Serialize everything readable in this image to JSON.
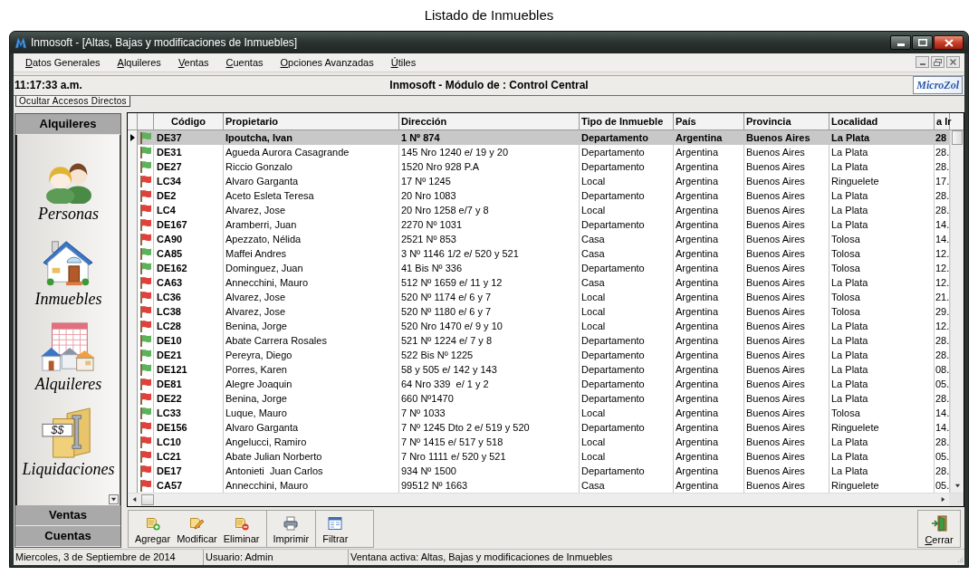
{
  "caption": "Listado de Inmuebles",
  "window": {
    "title": "Inmosoft - [Altas, Bajas y modificaciones de Inmuebles]"
  },
  "menu": [
    "Datos Generales",
    "Alquileres",
    "Ventas",
    "Cuentas",
    "Opciones Avanzadas",
    "Útiles"
  ],
  "header_bar": {
    "clock": "11:17:33 a.m.",
    "title": "Inmosoft - Módulo de : Control Central",
    "logo": "MicroZol"
  },
  "shortcuts_toggle": "Ocultar Accesos Directos",
  "sidebar": {
    "sections": [
      {
        "label": "Alquileres",
        "items": [
          {
            "label": "Personas",
            "kind": "people"
          },
          {
            "label": "Inmuebles",
            "kind": "house"
          },
          {
            "label": "Alquileres",
            "kind": "rentals"
          },
          {
            "label": "Liquidaciones",
            "kind": "settlement",
            "icon_text": "$$"
          }
        ]
      },
      {
        "label": "Ventas"
      },
      {
        "label": "Cuentas"
      }
    ]
  },
  "table": {
    "columns": [
      "Código",
      "Propietario",
      "Dirección",
      "Tipo de Inmueble",
      "País",
      "Provincia",
      "Localidad",
      "a Ir"
    ],
    "rows": [
      {
        "selected": true,
        "color": "#5db35a",
        "cells": [
          "DE37",
          "Ipoutcha, Ivan",
          "1 Nº 874",
          "Departamento",
          "Argentina",
          "Buenos Aires",
          "La Plata",
          "28"
        ]
      },
      {
        "selected": false,
        "color": "#5db35a",
        "cells": [
          "DE31",
          "Agueda Aurora Casagrande",
          "145 Nro 1240 e/ 19 y 20",
          "Departamento",
          "Argentina",
          "Buenos Aires",
          "La Plata",
          "28."
        ]
      },
      {
        "selected": false,
        "color": "#5db35a",
        "cells": [
          "DE27",
          "Riccio Gonzalo",
          "1520 Nro 928 P.A",
          "Departamento",
          "Argentina",
          "Buenos Aires",
          "La Plata",
          "28."
        ]
      },
      {
        "selected": false,
        "color": "#e2403a",
        "cells": [
          "LC34",
          "Alvaro Garganta",
          "17 Nº 1245",
          "Local",
          "Argentina",
          "Buenos Aires",
          "Ringuelete",
          "17."
        ]
      },
      {
        "selected": false,
        "color": "#e2403a",
        "cells": [
          "DE2",
          "Aceto Esleta Teresa",
          "20 Nro 1083",
          "Departamento",
          "Argentina",
          "Buenos Aires",
          "La Plata",
          "28."
        ]
      },
      {
        "selected": false,
        "color": "#e2403a",
        "cells": [
          "LC4",
          "Alvarez, Jose",
          "20 Nro 1258 e/7 y 8",
          "Local",
          "Argentina",
          "Buenos Aires",
          "La Plata",
          "28."
        ]
      },
      {
        "selected": false,
        "color": "#e2403a",
        "cells": [
          "DE167",
          "Aramberri, Juan",
          "2270 Nº 1031",
          "Departamento",
          "Argentina",
          "Buenos Aires",
          "La Plata",
          "14."
        ]
      },
      {
        "selected": false,
        "color": "#e2403a",
        "cells": [
          "CA90",
          "Apezzato, Nélida",
          "2521 Nº 853",
          "Casa",
          "Argentina",
          "Buenos Aires",
          "Tolosa",
          "14."
        ]
      },
      {
        "selected": false,
        "color": "#5db35a",
        "cells": [
          "CA85",
          "Maffei Andres",
          "3 Nº 1146 1/2 e/ 520 y 521",
          "Casa",
          "Argentina",
          "Buenos Aires",
          "Tolosa",
          "12."
        ]
      },
      {
        "selected": false,
        "color": "#5db35a",
        "cells": [
          "DE162",
          "Dominguez, Juan",
          "41 Bis Nº 336",
          "Departamento",
          "Argentina",
          "Buenos Aires",
          "Tolosa",
          "12."
        ]
      },
      {
        "selected": false,
        "color": "#e2403a",
        "cells": [
          "CA63",
          "Annecchini, Mauro",
          "512 Nº 1659 e/ 11 y 12",
          "Casa",
          "Argentina",
          "Buenos Aires",
          "La Plata",
          "12."
        ]
      },
      {
        "selected": false,
        "color": "#e2403a",
        "cells": [
          "LC36",
          "Alvarez, Jose",
          "520 Nº 1174 e/ 6 y 7",
          "Local",
          "Argentina",
          "Buenos Aires",
          "Tolosa",
          "21."
        ]
      },
      {
        "selected": false,
        "color": "#e2403a",
        "cells": [
          "LC38",
          "Alvarez, Jose",
          "520 Nº 1180 e/ 6 y 7",
          "Local",
          "Argentina",
          "Buenos Aires",
          "Tolosa",
          "29."
        ]
      },
      {
        "selected": false,
        "color": "#e2403a",
        "cells": [
          "LC28",
          "Benina, Jorge",
          "520 Nro 1470 e/ 9 y 10",
          "Local",
          "Argentina",
          "Buenos Aires",
          "La Plata",
          "12."
        ]
      },
      {
        "selected": false,
        "color": "#5db35a",
        "cells": [
          "DE10",
          "Abate Carrera Rosales",
          "521 Nº 1224 e/ 7 y 8",
          "Departamento",
          "Argentina",
          "Buenos Aires",
          "La Plata",
          "28."
        ]
      },
      {
        "selected": false,
        "color": "#5db35a",
        "cells": [
          "DE21",
          "Pereyra, Diego",
          "522 Bis Nº 1225",
          "Departamento",
          "Argentina",
          "Buenos Aires",
          "La Plata",
          "28."
        ]
      },
      {
        "selected": false,
        "color": "#5db35a",
        "cells": [
          "DE121",
          "Porres, Karen",
          "58 y 505 e/ 142 y 143",
          "Departamento",
          "Argentina",
          "Buenos Aires",
          "La Plata",
          "08."
        ]
      },
      {
        "selected": false,
        "color": "#e2403a",
        "cells": [
          "DE81",
          "Alegre Joaquin",
          "64 Nro 339  e/ 1 y 2",
          "Departamento",
          "Argentina",
          "Buenos Aires",
          "La Plata",
          "05."
        ]
      },
      {
        "selected": false,
        "color": "#e2403a",
        "cells": [
          "DE22",
          "Benina, Jorge",
          "660 Nº1470",
          "Departamento",
          "Argentina",
          "Buenos Aires",
          "La Plata",
          "28."
        ]
      },
      {
        "selected": false,
        "color": "#5db35a",
        "cells": [
          "LC33",
          "Luque, Mauro",
          "7 Nº 1033",
          "Local",
          "Argentina",
          "Buenos Aires",
          "Tolosa",
          "14."
        ]
      },
      {
        "selected": false,
        "color": "#e2403a",
        "cells": [
          "DE156",
          "Alvaro Garganta",
          "7 Nº 1245 Dto 2 e/ 519 y 520",
          "Departamento",
          "Argentina",
          "Buenos Aires",
          "Ringuelete",
          "14."
        ]
      },
      {
        "selected": false,
        "color": "#e2403a",
        "cells": [
          "LC10",
          "Angelucci, Ramiro",
          "7 Nº 1415 e/ 517 y 518",
          "Local",
          "Argentina",
          "Buenos Aires",
          "La Plata",
          "28."
        ]
      },
      {
        "selected": false,
        "color": "#e2403a",
        "cells": [
          "LC21",
          "Abate Julian Norberto",
          "7 Nro 1111 e/ 520 y 521",
          "Local",
          "Argentina",
          "Buenos Aires",
          "La Plata",
          "05."
        ]
      },
      {
        "selected": false,
        "color": "#e2403a",
        "cells": [
          "DE17",
          "Antonieti  Juan Carlos",
          "934 Nº 1500",
          "Departamento",
          "Argentina",
          "Buenos Aires",
          "La Plata",
          "28."
        ]
      },
      {
        "selected": false,
        "color": "#e2403a",
        "cells": [
          "CA57",
          "Annecchini, Mauro",
          "99512 Nº 1663",
          "Casa",
          "Argentina",
          "Buenos Aires",
          "Ringuelete",
          "05."
        ]
      }
    ]
  },
  "toolbar": {
    "groups": [
      {
        "buttons": [
          {
            "label": "Agregar",
            "kind": "add"
          },
          {
            "label": "Modificar",
            "kind": "edit"
          },
          {
            "label": "Eliminar",
            "kind": "delete"
          }
        ]
      },
      {
        "buttons": [
          {
            "label": "Imprimir",
            "kind": "print"
          }
        ]
      },
      {
        "buttons": [
          {
            "label": "Filtrar",
            "kind": "filter"
          }
        ]
      }
    ]
  },
  "close_button": {
    "label": "Cerrar",
    "kind": "exit"
  },
  "status_bar": [
    "Miercoles, 3 de Septiembre de 2014",
    "Usuario: Admin",
    "Ventana activa: Altas, Bajas y modificaciones de Inmuebles"
  ]
}
